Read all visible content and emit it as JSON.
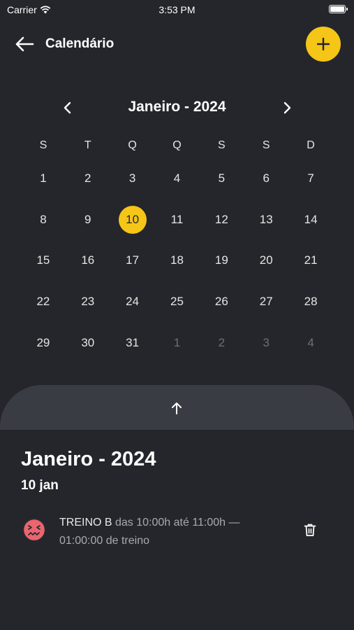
{
  "status_bar": {
    "carrier": "Carrier",
    "time": "3:53 PM"
  },
  "header": {
    "title": "Calendário",
    "back_icon": "arrow-left-icon",
    "add_icon": "plus-icon"
  },
  "calendar": {
    "month_label": "Janeiro - 2024",
    "weekdays": [
      "S",
      "T",
      "Q",
      "Q",
      "S",
      "S",
      "D"
    ],
    "weeks": [
      [
        "1",
        "2",
        "3",
        "4",
        "5",
        "6",
        "7"
      ],
      [
        "8",
        "9",
        "10",
        "11",
        "12",
        "13",
        "14"
      ],
      [
        "15",
        "16",
        "17",
        "18",
        "19",
        "20",
        "21"
      ],
      [
        "22",
        "23",
        "24",
        "25",
        "26",
        "27",
        "28"
      ],
      [
        "29",
        "30",
        "31",
        "1",
        "2",
        "3",
        "4"
      ]
    ],
    "selected_day": "10"
  },
  "sheet": {
    "month_label": "Janeiro - 2024",
    "date_label": "10 jan",
    "events": [
      {
        "name": "TREINO B",
        "detail": " das 10:00h até 11:00h — 01:00:00 de treino",
        "icon": "confounded-face-icon"
      }
    ]
  },
  "colors": {
    "background": "#25262b",
    "accent": "#f5c518",
    "sheet_handle": "#3a3c44",
    "event_face": "#e9656f"
  }
}
